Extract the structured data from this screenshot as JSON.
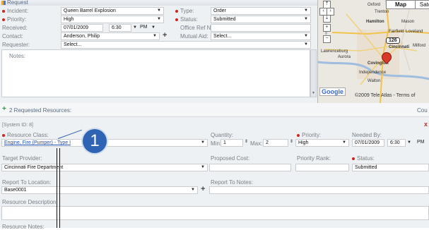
{
  "request": {
    "title": "Request",
    "incident_label": "Incident:",
    "incident_value": "Queen Barrel Explosion",
    "priority_label": "Priority:",
    "priority_value": "High",
    "received_label": "Received:",
    "received_date": "07/01/2009",
    "received_time": "6:30",
    "received_ampm": "PM",
    "contact_label": "Contact:",
    "contact_value": "Anderson, Philip",
    "requester_label": "Requester:",
    "requester_value": "Select...",
    "type_label": "Type:",
    "type_value": "Order",
    "status_label": "Status:",
    "status_value": "Submitted",
    "office_ref_label": "Office Ref No:",
    "office_ref_value": "",
    "mutual_aid_label": "Mutual Aid:",
    "mutual_aid_value": "Select...",
    "notes_label": "Notes:"
  },
  "map": {
    "map_button": "Map",
    "satellite_button": "Satel",
    "places": [
      "Oxford",
      "Trenton",
      "Hamilton",
      "Mason",
      "Fairfield",
      "Loveland",
      "Lawrenceburg",
      "Cincinnati",
      "Milford",
      "Aurora",
      "Covington",
      "Independence",
      "Walton"
    ],
    "route_shield": "126",
    "copyright": "©2009 Tele Atlas - Terms of",
    "google": "Google"
  },
  "resources": {
    "title": "2 Requested Resources:",
    "right_label": "Cou",
    "system_id": "[System ID: 8]",
    "resource_class_label": "Resource Class:",
    "resource_class_value": "Engine, Fire (Pumper) - Type I",
    "quantity_label": "Quantity:",
    "min_label": "Min:",
    "min_value": "1",
    "max_label": "Max:",
    "max_value": "2",
    "priority_label": "Priority:",
    "priority_value": "High",
    "needed_by_label": "Needed By:",
    "needed_by_date": "07/01/2009",
    "needed_by_time": "6:30",
    "needed_by_ampm": "PM",
    "target_provider_label": "Target Provider:",
    "target_provider_value": "Cincinnati Fire Department",
    "proposed_cost_label": "Proposed Cost:",
    "priority_rank_label": "Priority Rank:",
    "status_label": "Status:",
    "status_value": "Submitted",
    "report_to_location_label": "Report To Location:",
    "report_to_location_value": "Base0001",
    "report_to_notes_label": "Report To Notes:",
    "resource_description_label": "Resource Description:",
    "resource_notes_label": "Resource Notes:"
  },
  "callout": {
    "number": "1"
  },
  "colors": {
    "accent_blue": "#2f63b3",
    "required_red": "#d3231f",
    "link_blue": "#1d4fb8"
  }
}
